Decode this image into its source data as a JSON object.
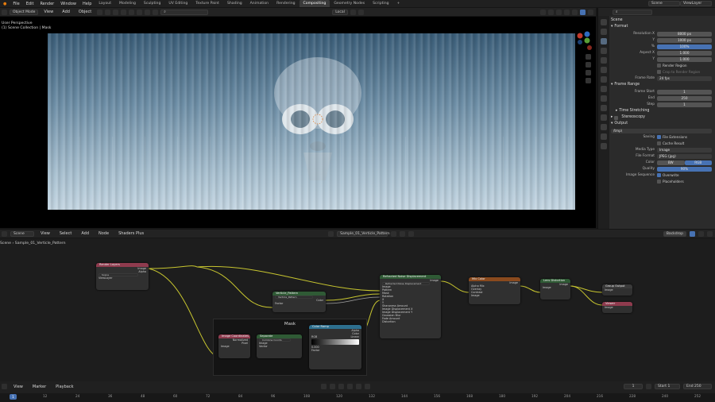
{
  "topbar": {
    "menus": [
      "File",
      "Edit",
      "Render",
      "Window",
      "Help"
    ],
    "workspaces": [
      "Layout",
      "Modeling",
      "Sculpting",
      "UV Editing",
      "Texture Paint",
      "Shading",
      "Animation",
      "Rendering",
      "Compositing",
      "Geometry Nodes",
      "Scripting"
    ],
    "active_workspace": "Compositing",
    "scene": "Scene",
    "view_layer": "ViewLayer"
  },
  "viewport": {
    "mode": "Object Mode",
    "menus": [
      "View",
      "Add",
      "Object"
    ],
    "orientation": "Local",
    "overlay_line1": "User Perspective",
    "overlay_line2": "(1) Scene Collection | Mask"
  },
  "properties": {
    "search_placeholder": "",
    "scene_label": "Scene",
    "format_header": "Format",
    "resolution_x_label": "Resolution X",
    "resolution_x": "8000 px",
    "resolution_y_label": "Y",
    "resolution_y": "1000 px",
    "resolution_pct_label": "%",
    "resolution_pct": "100%",
    "aspect_x_label": "Aspect X",
    "aspect_x": "1.000",
    "aspect_y_label": "Y",
    "aspect_y": "1.000",
    "render_region": "Render Region",
    "crop_region": "Crop to Render Region",
    "frame_rate_label": "Frame Rate",
    "frame_rate": "24 fps",
    "frame_range_header": "Frame Range",
    "frame_start_label": "Frame Start",
    "frame_start": "1",
    "frame_end_label": "End",
    "frame_end": "250",
    "frame_step_label": "Step",
    "frame_step": "1",
    "time_stretching": "Time Stretching",
    "stereoscopy": "Stereoscopy",
    "output_header": "Output",
    "output_path": "/tmp\\",
    "saving_label": "Saving",
    "file_extensions": "File Extensions",
    "cache_result": "Cache Result",
    "media_type_label": "Media Type",
    "media_type": "Image",
    "file_format_label": "File Format",
    "file_format": "JPEG (jpg)",
    "color_label": "Color",
    "color_bw": "BW",
    "color_rgb": "RGB",
    "quality_label": "Quality",
    "quality": "90%",
    "image_sequence_label": "Image Sequence",
    "overwrite": "Overwrite",
    "placeholders": "Placeholders"
  },
  "node_editor": {
    "editor_menu": "Scene",
    "menus": [
      "View",
      "Select",
      "Add",
      "Node",
      "Shaders Plus"
    ],
    "node_tree": "Sample_01_Verticle_Pattern",
    "breadcrumb_scene": "Scene",
    "breadcrumb_tree": "Sample_01_Verticle_Pattern",
    "backdrop": "Backdrop",
    "frame_label": "Mask",
    "nodes": {
      "render_layers": {
        "title": "Render Layers",
        "out1": "Image",
        "out2": "Alpha",
        "field1": "Scene",
        "field2": "ViewLayer"
      },
      "vertical_pattern": {
        "title": "Verticle_Pattern",
        "field": "Verticle_Pattern",
        "out": "Color",
        "in": "Factor"
      },
      "displace": {
        "title": "Refracted Noise Displacement",
        "field": "Refracted Noise Displacement",
        "out": "Image",
        "rows": [
          "Image",
          "Pattern",
          "Mask",
          "Rotation",
          "X",
          "Y",
          "Sharpness Amount",
          "Image Displacement X",
          "Image Displacement Y",
          "Gaussian Blur",
          "Fade Amount",
          "Distortion"
        ]
      },
      "mix": {
        "title": "Mix Color",
        "out": "Image",
        "rows": [
          "Alpha Mix",
          "Overlay",
          "Contrast",
          "Image"
        ]
      },
      "lens": {
        "title": "Lens Distortion",
        "out": "Image",
        "in": "Image"
      },
      "group_output": {
        "title": "Group Output",
        "row": "Image"
      },
      "viewer": {
        "title": "Viewer",
        "row": "Image"
      },
      "image_info": {
        "title": "Image Coordinates",
        "rows": [
          "Image",
          "Normalized",
          "Pixel"
        ]
      },
      "separate": {
        "title": "Separate",
        "field": "Combine Coords",
        "rows": [
          "Image",
          "Vector"
        ]
      },
      "color_ramp": {
        "title": "Color Ramp",
        "out1": "Alpha",
        "out2": "Color",
        "in": "Factor",
        "rgb": "RGB",
        "linear": "Linear",
        "pos": "0.000"
      }
    }
  },
  "timeline": {
    "menus": [
      "View",
      "Marker",
      "Playback"
    ],
    "current_frame": "1",
    "start_label": "Start",
    "start": "1",
    "end_label": "End",
    "end": "250",
    "ticks": [
      "1",
      "12",
      "24",
      "36",
      "48",
      "60",
      "72",
      "84",
      "96",
      "108",
      "120",
      "132",
      "144",
      "156",
      "168",
      "180",
      "192",
      "204",
      "216",
      "228",
      "240",
      "252"
    ]
  }
}
